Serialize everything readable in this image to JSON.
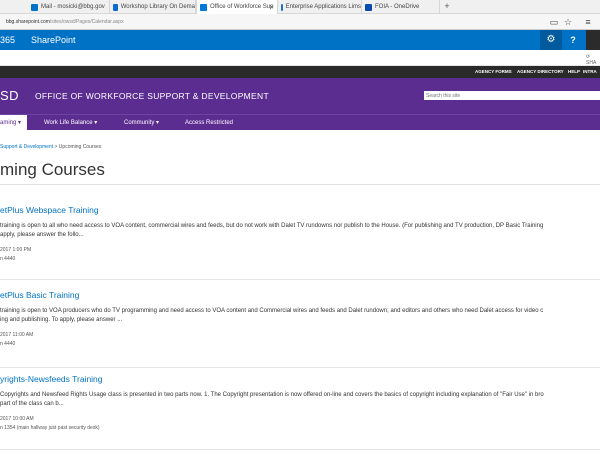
{
  "browser": {
    "tabs": [
      {
        "label": "Mail - mosicki@bbg.gov",
        "color": "#0072c6",
        "active": false
      },
      {
        "label": "Workshop Library On Dema",
        "color": "#0b6ad1",
        "active": false
      },
      {
        "label": "Office of Workforce Sup",
        "color": "#0078d7",
        "active": true
      },
      {
        "label": "Enterprise Applications Lims",
        "color": "#1a73c9",
        "active": false
      },
      {
        "label": "FOIA - OneDrive",
        "color": "#094ab2",
        "active": false
      }
    ],
    "new_tab": "+",
    "url_domain": "bbg.sharepoint.com",
    "url_path": "/sites/owsd/Pages/Calendar.aspx"
  },
  "suite": {
    "o365": "365",
    "app": "SharePoint",
    "gear": "⚙",
    "help": "?"
  },
  "share": {
    "label": "SHA"
  },
  "topbar": {
    "items": [
      "AGENCY FORMS",
      "AGENCY DIRECTORY",
      "HELP",
      "INTRA"
    ]
  },
  "banner": {
    "logo": "SD",
    "title": "OFFICE OF WORKFORCE SUPPORT & DEVELOPMENT",
    "search_placeholder": "Search this site"
  },
  "nav": {
    "items": [
      "aming",
      "Work Life Balance",
      "Community",
      "Access Restricted"
    ]
  },
  "breadcrumb": {
    "link": "Support & Development",
    "sep": " > ",
    "current": "Upcoming Courses"
  },
  "page_title": "ming Courses",
  "courses": [
    {
      "title": "etPlus Webspace Training",
      "desc1": "training is open to all who need access to VOA content, commercial wires and feeds, but do not work with Dalet TV rundowns nor publish to the House. (For publishing and TV production, DP Basic Training",
      "desc2": "apply, please answer the follo...",
      "date": "2017 1:00 PM",
      "location": "n 4440"
    },
    {
      "title": "etPlus Basic Training",
      "desc1": "training is open to VOA producers who do TV programming and need access to VOA content and Commercial wires and feeds and Dalet rundown; and editors and others who need Dalet access for video c",
      "desc2": "ing and publishing. To apply, please answer ...",
      "date": "2017 11:00 AM",
      "location": "n 4440"
    },
    {
      "title": "yrights-Newsfeeds Training",
      "desc1": "Copyrights and Newsfeed Rights Usage class is presented in two parts now. 1. The Copyright presentation is now offered on-line and covers the basics of copyright including explanation of \"Fair Use\" in bro",
      "desc2": "part of the class can b...",
      "date": "2017 10:00 AM",
      "location": "n 1354 (main hallway just past security desk)"
    }
  ]
}
